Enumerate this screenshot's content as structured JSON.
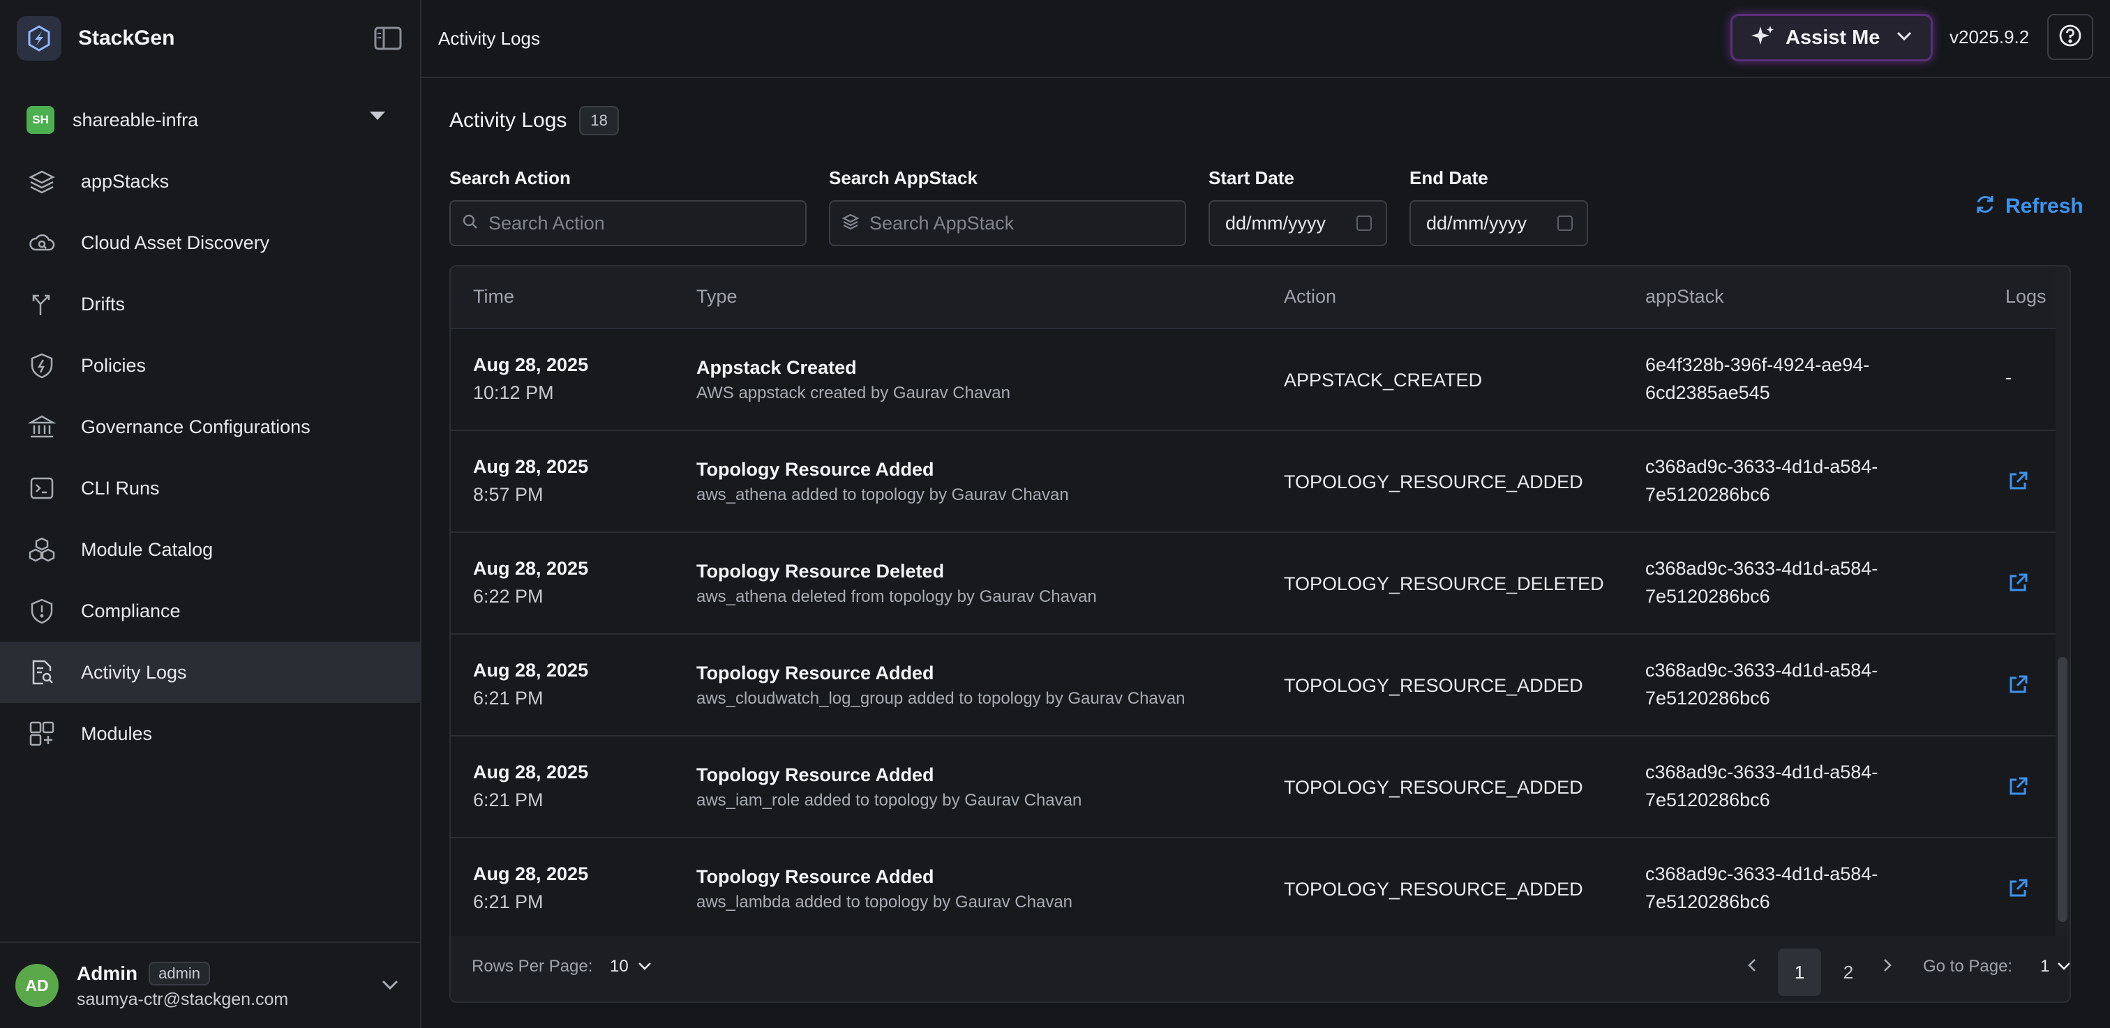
{
  "app": {
    "name": "StackGen"
  },
  "org": {
    "badge": "SH",
    "name": "shareable-infra"
  },
  "nav": [
    {
      "label": "appStacks",
      "icon": "layers-icon"
    },
    {
      "label": "Cloud Asset Discovery",
      "icon": "cloud-search-icon"
    },
    {
      "label": "Drifts",
      "icon": "branch-icon"
    },
    {
      "label": "Policies",
      "icon": "shield-bolt-icon"
    },
    {
      "label": "Governance Configurations",
      "icon": "bank-icon"
    },
    {
      "label": "CLI Runs",
      "icon": "terminal-icon"
    },
    {
      "label": "Module Catalog",
      "icon": "cubes-icon"
    },
    {
      "label": "Compliance",
      "icon": "shield-alert-icon"
    },
    {
      "label": "Activity Logs",
      "icon": "file-search-icon",
      "active": true
    },
    {
      "label": "Modules",
      "icon": "grid-plus-icon"
    }
  ],
  "user": {
    "initials": "AD",
    "name": "Admin",
    "role": "admin",
    "email": "saumya-ctr@stackgen.com"
  },
  "topbar": {
    "title": "Activity Logs",
    "assist_label": "Assist Me",
    "version": "v2025.9.2"
  },
  "heading": {
    "title": "Activity Logs",
    "count": "18"
  },
  "filters": {
    "action": {
      "label": "Search Action",
      "placeholder": "Search Action"
    },
    "appstack": {
      "label": "Search AppStack",
      "placeholder": "Search AppStack"
    },
    "start": {
      "label": "Start Date",
      "value": "dd/mm/yyyy"
    },
    "end": {
      "label": "End Date",
      "value": "dd/mm/yyyy"
    },
    "refresh_label": "Refresh"
  },
  "table": {
    "headers": {
      "time": "Time",
      "type": "Type",
      "action": "Action",
      "appstack": "appStack",
      "logs": "Logs"
    },
    "rows": [
      {
        "date": "Aug 28, 2025",
        "time": "10:12 PM",
        "title": "Appstack Created",
        "desc": "AWS appstack created by Gaurav Chavan",
        "action": "APPSTACK_CREATED",
        "stack1": "6e4f328b-396f-4924-ae94-",
        "stack2": "6cd2385ae545",
        "log": "-"
      },
      {
        "date": "Aug 28, 2025",
        "time": "8:57 PM",
        "title": "Topology Resource Added",
        "desc": "aws_athena added to topology by Gaurav Chavan",
        "action": "TOPOLOGY_RESOURCE_ADDED",
        "stack1": "c368ad9c-3633-4d1d-a584-",
        "stack2": "7e5120286bc6",
        "log": "link"
      },
      {
        "date": "Aug 28, 2025",
        "time": "6:22 PM",
        "title": "Topology Resource Deleted",
        "desc": "aws_athena deleted from topology by Gaurav Chavan",
        "action": "TOPOLOGY_RESOURCE_DELETED",
        "stack1": "c368ad9c-3633-4d1d-a584-",
        "stack2": "7e5120286bc6",
        "log": "link"
      },
      {
        "date": "Aug 28, 2025",
        "time": "6:21 PM",
        "title": "Topology Resource Added",
        "desc": "aws_cloudwatch_log_group added to topology by Gaurav Chavan",
        "action": "TOPOLOGY_RESOURCE_ADDED",
        "stack1": "c368ad9c-3633-4d1d-a584-",
        "stack2": "7e5120286bc6",
        "log": "link"
      },
      {
        "date": "Aug 28, 2025",
        "time": "6:21 PM",
        "title": "Topology Resource Added",
        "desc": "aws_iam_role added to topology by Gaurav Chavan",
        "action": "TOPOLOGY_RESOURCE_ADDED",
        "stack1": "c368ad9c-3633-4d1d-a584-",
        "stack2": "7e5120286bc6",
        "log": "link"
      },
      {
        "date": "Aug 28, 2025",
        "time": "6:21 PM",
        "title": "Topology Resource Added",
        "desc": "aws_lambda added to topology by Gaurav Chavan",
        "action": "TOPOLOGY_RESOURCE_ADDED",
        "stack1": "c368ad9c-3633-4d1d-a584-",
        "stack2": "7e5120286bc6",
        "log": "link"
      }
    ]
  },
  "pagination": {
    "rows_label": "Rows Per Page:",
    "rows_value": "10",
    "pages": [
      "1",
      "2"
    ],
    "current": "1",
    "goto_label": "Go to Page:",
    "goto_value": "1"
  },
  "colors": {
    "accent": "#3b94f0",
    "assist_glow": "#aa50dc",
    "org_badge": "#4caf50",
    "avatar": "#5aa84a"
  }
}
